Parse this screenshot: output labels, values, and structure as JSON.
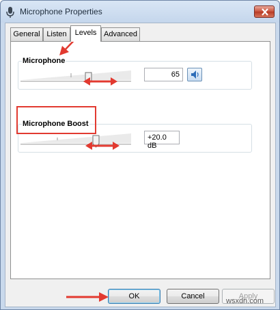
{
  "window": {
    "title": "Microphone Properties",
    "icons": {
      "title": "microphone-icon",
      "close": "close-icon"
    }
  },
  "tabs": [
    {
      "label": "General",
      "active": false
    },
    {
      "label": "Listen",
      "active": false
    },
    {
      "label": "Levels",
      "active": true
    },
    {
      "label": "Advanced",
      "active": false
    }
  ],
  "levels": {
    "microphone": {
      "label": "Microphone",
      "value_text": "65",
      "level": 0.65,
      "mute_icon": "speaker-icon"
    },
    "boost": {
      "label": "Microphone Boost",
      "value_text": "+20.0 dB",
      "level": 0.67
    }
  },
  "buttons": {
    "ok": "OK",
    "cancel": "Cancel",
    "apply": "Apply"
  },
  "watermark": "wsxdn.com",
  "colors": {
    "annotation": "#e23a30",
    "accent": "#3c7fb1"
  }
}
